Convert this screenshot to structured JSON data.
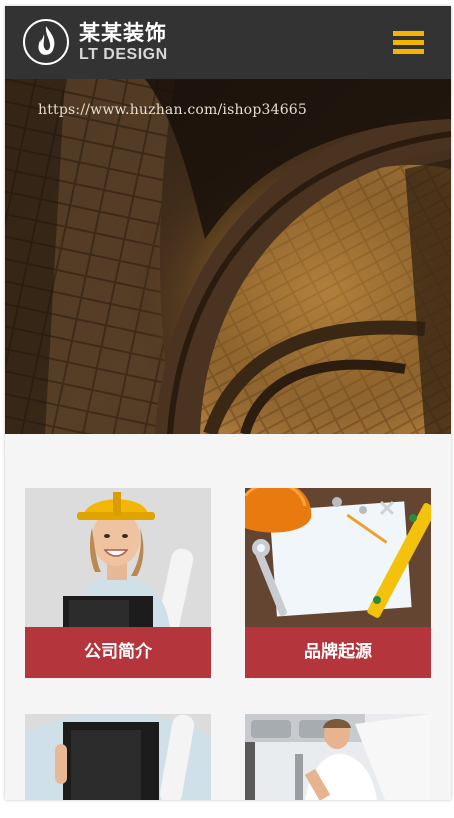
{
  "header": {
    "logo_title": "某某装饰",
    "logo_sub": "LT DESIGN",
    "menu_icon": "hamburger-menu-icon"
  },
  "hero": {
    "watermark_url": "https://www.huzhan.com/ishop34665"
  },
  "cards": [
    {
      "label": "公司简介"
    },
    {
      "label": "品牌起源"
    },
    {
      "label": ""
    },
    {
      "label": ""
    }
  ],
  "colors": {
    "header_bg": "#333333",
    "accent_yellow": "#f5b400",
    "card_label_bg": "#b4363c",
    "page_bg": "#f5f5f5"
  }
}
